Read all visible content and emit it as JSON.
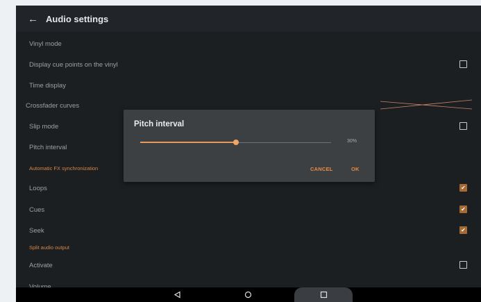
{
  "app_bar": {
    "title": "Audio settings",
    "back_icon": "back-arrow-icon"
  },
  "rows": {
    "vinyl_mode": "Vinyl mode",
    "display_cue_points": "Display cue points on the vinyl",
    "time_display": "Time display",
    "crossfader_curves": "Crossfader curves",
    "slip_mode": "Slip mode",
    "pitch_interval": "Pitch interval",
    "loops": "Loops",
    "cues": "Cues",
    "seek": "Seek",
    "activate": "Activate",
    "volume": "Volume"
  },
  "sections": {
    "automatic_fx": "Automatic FX synchronization",
    "split_audio": "Split audio output"
  },
  "checkboxes": {
    "display_cue_points": false,
    "slip_mode": false,
    "loops": true,
    "cues": true,
    "seek": true,
    "activate": false
  },
  "dialog": {
    "title": "Pitch interval",
    "slider_fraction": 0.5,
    "value_label": "30%",
    "cancel_label": "CANCEL",
    "ok_label": "OK"
  },
  "nav_bar": {
    "icons": [
      "back-triangle-icon",
      "home-circle-icon",
      "recents-square-icon"
    ]
  },
  "colors": {
    "accent": "#e68b45",
    "background": "#1c1f22",
    "dialog": "#3d4043"
  }
}
